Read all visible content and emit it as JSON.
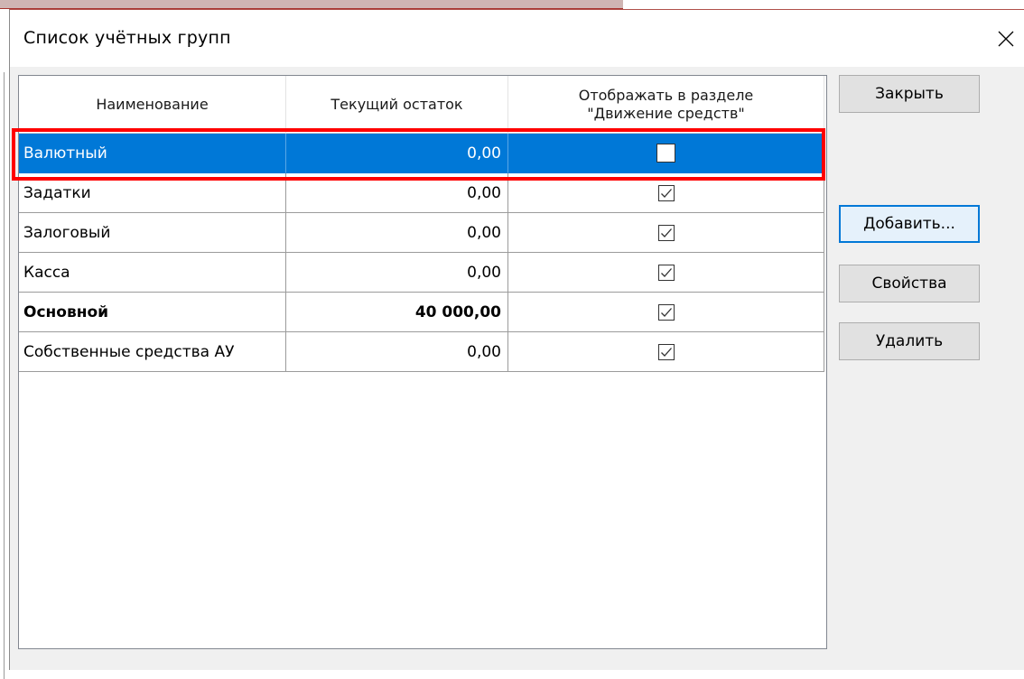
{
  "dialog": {
    "title": "Список учётных групп",
    "close_icon": "close-icon"
  },
  "table": {
    "headers": [
      "Наименование",
      "Текущий остаток",
      "Отображать в разделе\n\"Движение средств\""
    ],
    "rows": [
      {
        "name": "Валютный",
        "balance": "0,00",
        "show_in_cashflow": false,
        "selected": true,
        "bold": false
      },
      {
        "name": "Задатки",
        "balance": "0,00",
        "show_in_cashflow": true,
        "selected": false,
        "bold": false
      },
      {
        "name": "Залоговый",
        "balance": "0,00",
        "show_in_cashflow": true,
        "selected": false,
        "bold": false
      },
      {
        "name": "Касса",
        "balance": "0,00",
        "show_in_cashflow": true,
        "selected": false,
        "bold": false
      },
      {
        "name": "Основной",
        "balance": "40 000,00",
        "show_in_cashflow": true,
        "selected": false,
        "bold": true
      },
      {
        "name": "Собственные средства АУ",
        "balance": "0,00",
        "show_in_cashflow": true,
        "selected": false,
        "bold": false
      }
    ]
  },
  "buttons": {
    "close": "Закрыть",
    "add": "Добавить...",
    "properties": "Свойства",
    "delete": "Удалить"
  },
  "colors": {
    "selection": "#0078d7",
    "highlight_frame": "#ff0000"
  }
}
